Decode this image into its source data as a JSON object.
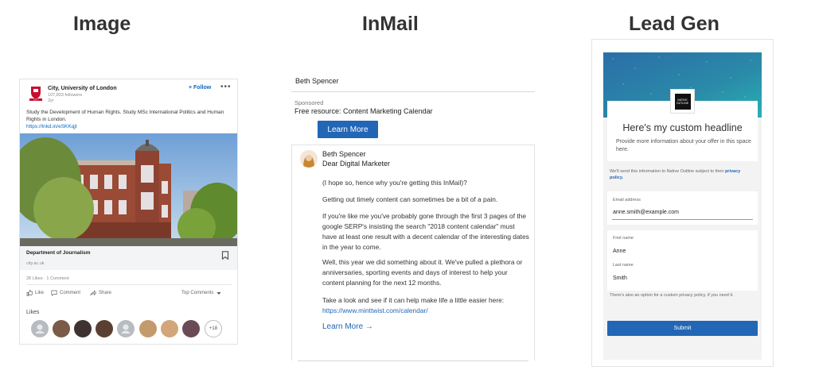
{
  "headings": {
    "image": "Image",
    "inmail": "InMail",
    "leadgen": "Lead Gen"
  },
  "image_ad": {
    "company_name": "City, University of London",
    "followers": "107,833 followers",
    "age": "2yr",
    "follow_label": "+ Follow",
    "more_label": "•••",
    "body_text": "Study the Development of Human Rights. Study MSc International Politics and Human Rights in London.",
    "link": "https://lnkd.in/eSKKqjt",
    "caption_title": "Department of Journalism",
    "caption_domain": "city.ac.uk",
    "counts": "28 Likes · 1 Comment",
    "actions": {
      "like": "Like",
      "comment": "Comment",
      "share": "Share",
      "sort": "Top Comments"
    },
    "likes_label": "Likes",
    "more_likers": "+18"
  },
  "inmail": {
    "sender_top": "Beth Spencer",
    "sponsored": "Sponsored",
    "subject": "Free resource: Content Marketing Calendar",
    "cta": "Learn More",
    "from": "Beth Spencer",
    "greeting": "Dear Digital Marketer",
    "para1": "(I hope so, hence why you're getting this InMail)?",
    "para2": " Getting out timely content can sometimes be a bit of a pain.",
    "para3": "If you're like me you've probably gone through the first 3 pages of the google SERP's insisting the search \"2018 content calendar\" must have at least one result with a decent calendar of the interesting dates in the year to come.",
    "para4": "Well, this year we did something about it. We've pulled a plethora or anniversaries, sporting events and days of interest to help your content planning for the next 12 months.",
    "para5": "Take a look and see if it can help make life a little easier here: ",
    "para5_link": "https://www.minttwist.com/calendar/",
    "learn_more": "Learn More →"
  },
  "leadgen": {
    "logo_text": "NATIVE OUTLINE",
    "headline": "Here's my custom headline",
    "description": "Provide more information about your offer in this space here.",
    "notice_prefix": "We'll send this information to Native Outline subject to their ",
    "notice_link": "privacy policy.",
    "email_label": "Email address",
    "email_value": "anne.smith@example.com",
    "first_name_label": "First name",
    "first_name_value": "Anne",
    "last_name_label": "Last name",
    "last_name_value": "Smith",
    "footnote": "There's also an option for a custom privacy policy, if you need it.",
    "submit": "Submit"
  },
  "colors": {
    "linkedin_blue": "#0a66c2",
    "button_blue": "#2266b6"
  }
}
